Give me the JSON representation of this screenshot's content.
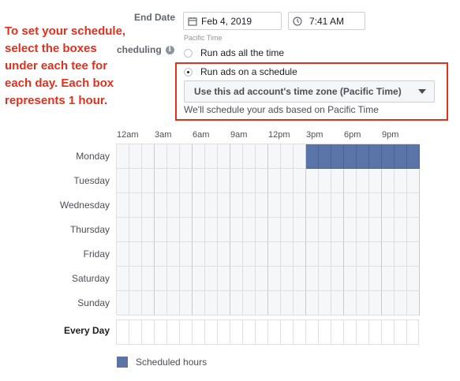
{
  "end_date": {
    "label": "End Date",
    "date": "Feb 4, 2019",
    "time": "7:41 AM",
    "timezone": "Pacific Time"
  },
  "scheduling": {
    "label": "cheduling",
    "option_all_time": "Run ads all the time",
    "option_schedule": "Run ads on a schedule",
    "selected": "Run ads on a schedule",
    "timezone_select": "Use this ad account's time zone (Pacific Time)",
    "timezone_note": "We'll schedule your ads based on Pacific Time"
  },
  "annotation": {
    "lines": [
      "To set your schedule,",
      "select the boxes",
      "under each tee for",
      "each day. Each box",
      "represents 1 hour."
    ]
  },
  "grid": {
    "hour_labels": [
      "12am",
      "3am",
      "6am",
      "9am",
      "12pm",
      "3pm",
      "6pm",
      "9pm"
    ],
    "days": [
      "Monday",
      "Tuesday",
      "Wednesday",
      "Thursday",
      "Friday",
      "Saturday",
      "Sunday"
    ],
    "every_day_label": "Every Day",
    "hours_per_day": 24,
    "scheduled": {
      "Monday": [
        15,
        16,
        17,
        18,
        19,
        20,
        21,
        22,
        23
      ]
    }
  },
  "legend": {
    "label": "Scheduled hours"
  },
  "colors": {
    "scheduled": "#5b74a8",
    "annotation": "#e0301e"
  }
}
